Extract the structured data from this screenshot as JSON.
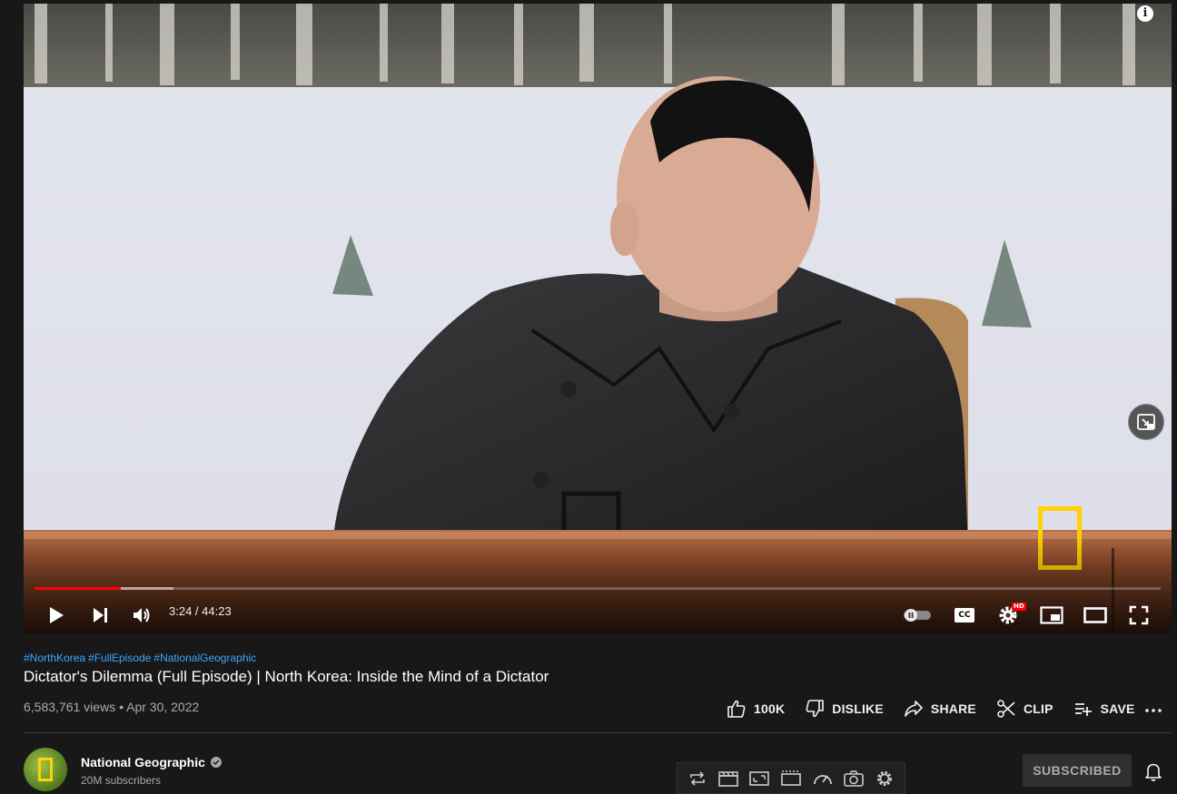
{
  "player": {
    "current_time": "3:24",
    "time_separator": " / ",
    "duration": "44:23",
    "progress_played": 0.0767,
    "progress_buffered": 0.1236,
    "info_glyph": "i",
    "icons": [
      "info-icon",
      "minimize-icon",
      "play-icon",
      "next-icon",
      "volume-icon",
      "autoplay-toggle-icon",
      "captions-icon",
      "settings-icon",
      "miniplayer-icon",
      "theater-icon",
      "fullscreen-icon"
    ],
    "captions_label": "CC",
    "settings_badge": "HD",
    "accent": "#ff0000"
  },
  "video": {
    "hashtags": [
      "#NorthKorea",
      "#FullEpisode",
      "#NationalGeographic"
    ],
    "title": "Dictator's Dilemma (Full Episode) | North Korea: Inside the Mind of a Dictator",
    "views": "6,583,761 views",
    "dot": "•",
    "date": "Apr 30, 2022"
  },
  "actions": {
    "like": "100K",
    "dislike": "DISLIKE",
    "share": "SHARE",
    "clip": "CLIP",
    "save": "SAVE",
    "more_icon": "more-horizontal-icon"
  },
  "channel": {
    "name": "National Geographic",
    "subscribers": "20M subscribers",
    "subscribe_button": "SUBSCRIBED",
    "brand_color": "#ffd200"
  },
  "extension_toolbar": {
    "icons": [
      "loop-icon",
      "clapperboard-icon",
      "screen-resize-icon",
      "cinema-icon",
      "speedometer-icon",
      "camera-icon",
      "gear-icon"
    ]
  },
  "colors": {
    "background": "#181818",
    "link": "#3ea6ff",
    "secondary_text": "#aaaaaa"
  }
}
